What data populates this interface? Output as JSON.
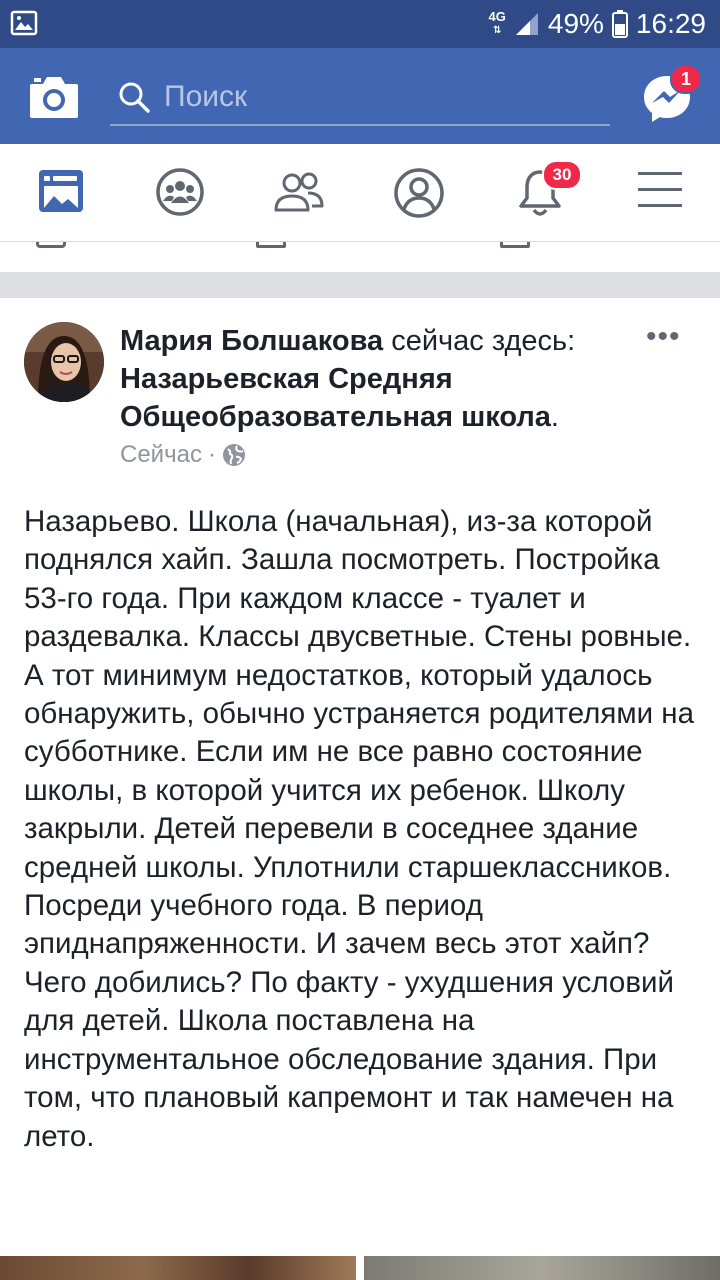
{
  "status_bar": {
    "network": "4G",
    "battery": "49%",
    "time": "16:29"
  },
  "header": {
    "search_placeholder": "Поиск",
    "messenger_badge": "1"
  },
  "nav": {
    "items": [
      "news-feed",
      "groups",
      "friends",
      "profile",
      "notifications",
      "menu"
    ],
    "notifications_badge": "30"
  },
  "post": {
    "author": "Мария Болшакова",
    "action": " сейчас здесь: ",
    "place": "Назарьевская Средняя Общеобразовательная школа",
    "place_suffix": ".",
    "time": "Сейчас",
    "more": "•••",
    "text": "Назарьево. Школа (начальная), из-за которой поднялся хайп. Зашла посмотреть. Постройка 53-го года. При каждом классе - туалет и раздевалка. Классы двусветные. Стены ровные. А тот минимум недостатков, который удалось обнаружить, обычно устраняется родителями на субботнике. Если им не все равно состояние школы, в которой учится их ребенок. Школу закрыли. Детей перевели в соседнее здание средней школы. Уплотнили старшеклассников. Посреди учебного года. В период эпиднапряженности. И зачем весь этот хайп? Чего добились? По факту - ухудшения условий для детей. Школа поставлена на инструментальное обследование здания. При том, что плановый капремонт и так намечен на лето."
  },
  "colors": {
    "status_bar": "#2f4a87",
    "header": "#4267b2",
    "icon_blue": "#4267b2",
    "icon_gray": "#606770",
    "badge": "#f02849"
  }
}
